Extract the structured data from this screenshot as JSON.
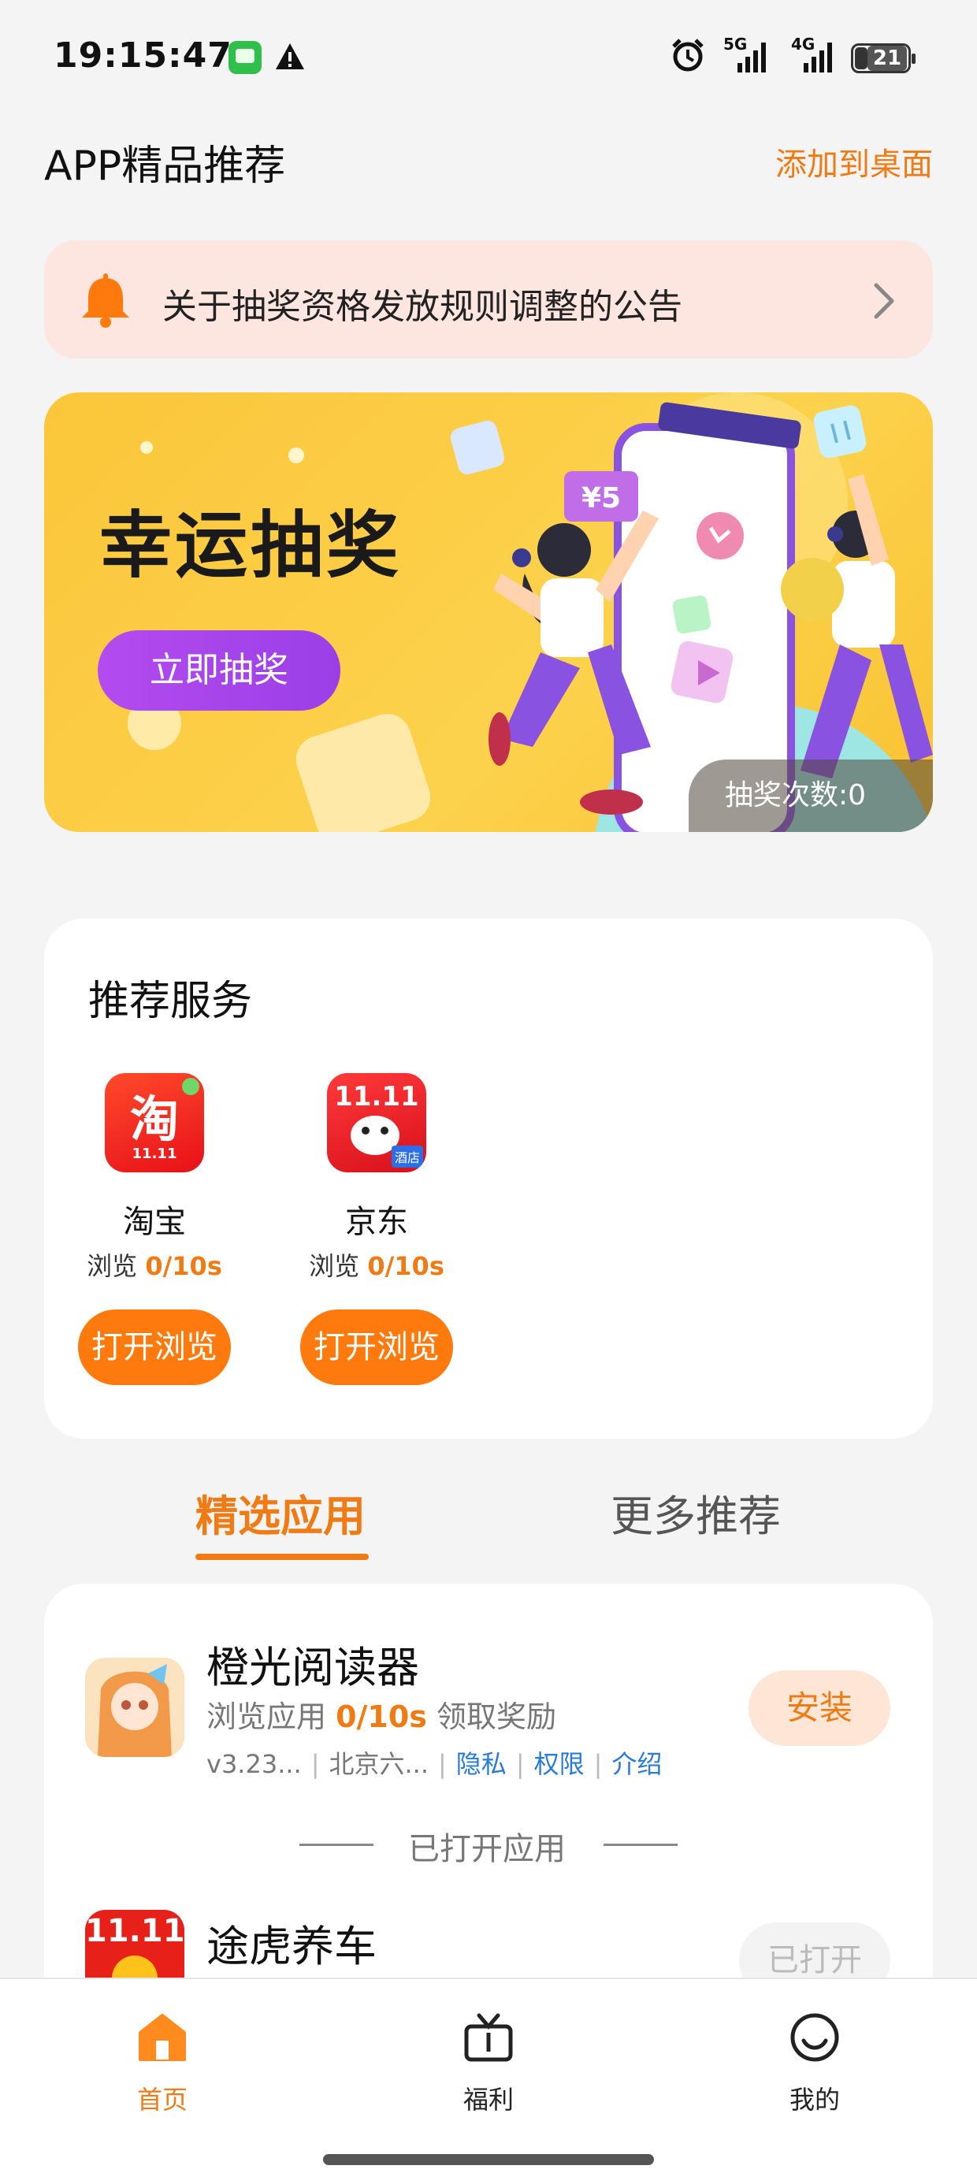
{
  "status_bar": {
    "time": "19:15:47",
    "network_1": "5G",
    "network_2": "4G",
    "battery": "21"
  },
  "header": {
    "title": "APP精品推荐",
    "add_to_desktop": "添加到桌面"
  },
  "notice": {
    "text": "关于抽奖资格发放规则调整的公告"
  },
  "banner": {
    "title": "幸运抽奖",
    "button": "立即抽奖",
    "count_label": "抽奖次数:0",
    "price_tag": "¥5"
  },
  "services": {
    "title": "推荐服务",
    "items": [
      {
        "name": "淘宝",
        "progress_prefix": "浏览",
        "progress": "0/10s",
        "button": "打开浏览",
        "icon_glyph": "淘",
        "icon_sub": "11.11"
      },
      {
        "name": "京东",
        "progress_prefix": "浏览",
        "progress": "0/10s",
        "button": "打开浏览",
        "icon_glyph": "11.11",
        "icon_sub": "酒店"
      }
    ]
  },
  "tabs": [
    {
      "label": "精选应用",
      "active": true
    },
    {
      "label": "更多推荐",
      "active": false
    }
  ],
  "apps": [
    {
      "name": "橙光阅读器",
      "sub_prefix": "浏览应用",
      "sub_progress": "0/10s",
      "sub_suffix": "领取奖励",
      "version": "v3.23...",
      "developer": "北京六...",
      "links": [
        "隐私",
        "权限",
        "介绍"
      ],
      "action": "安装"
    },
    {
      "name": "途虎养车",
      "action": "已打开",
      "icon_text": "11.11"
    }
  ],
  "divider_text": "已打开应用",
  "bottom_nav": [
    {
      "label": "首页",
      "icon": "home-icon",
      "active": true
    },
    {
      "label": "福利",
      "icon": "gift-tv-icon",
      "active": false
    },
    {
      "label": "我的",
      "icon": "smile-icon",
      "active": false
    }
  ],
  "colors": {
    "accent": "#f07a14",
    "button_orange": "#ff7a0c",
    "banner_yellow": "#fcd24c",
    "banner_button_purple": "#a945ea",
    "notice_bg": "#fde6df",
    "link_blue": "#2a7bd8"
  }
}
